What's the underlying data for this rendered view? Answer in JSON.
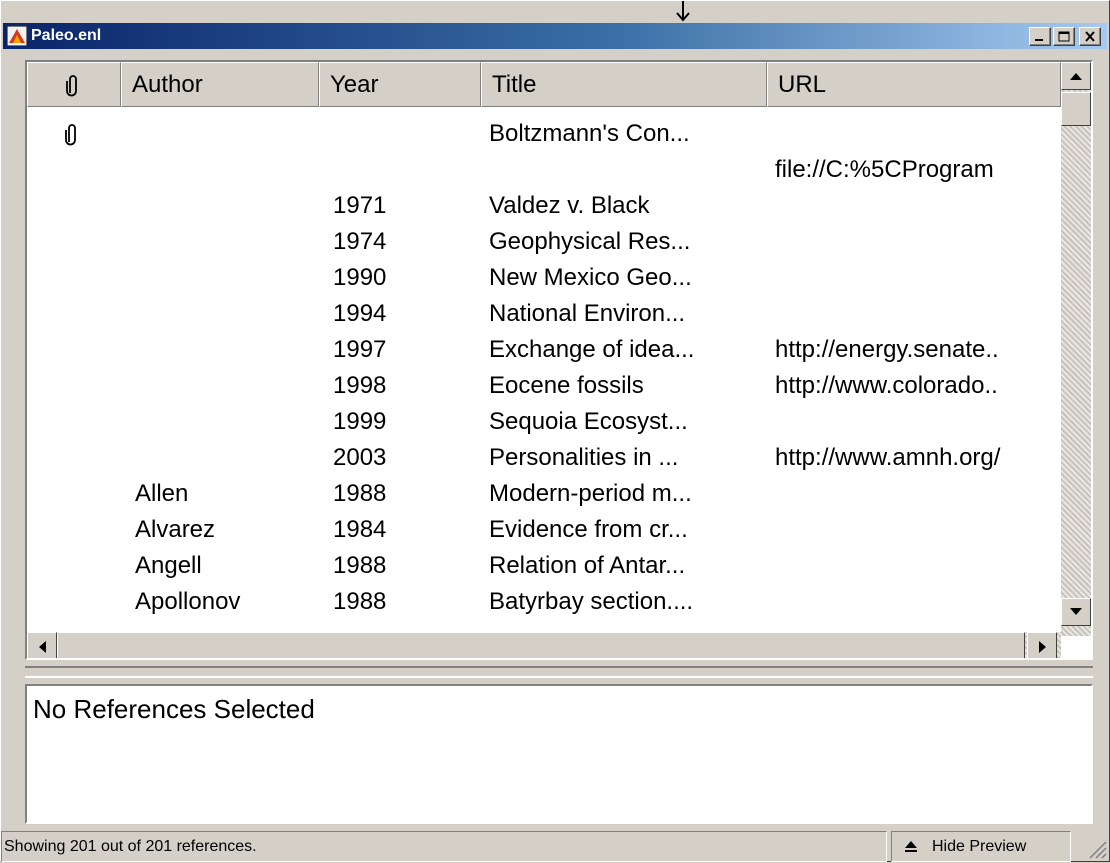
{
  "window": {
    "title": "Paleo.enl"
  },
  "columns": [
    {
      "label": ""
    },
    {
      "label": "Author"
    },
    {
      "label": "Year"
    },
    {
      "label": "Title"
    },
    {
      "label": "URL"
    }
  ],
  "rows": [
    {
      "attachment": true,
      "author": "",
      "year": "",
      "title": "Boltzmann's Con...",
      "url": ""
    },
    {
      "attachment": false,
      "author": "",
      "year": "",
      "title": "",
      "url": "file://C:%5CProgram"
    },
    {
      "attachment": false,
      "author": "",
      "year": "1971",
      "title": "Valdez v. Black",
      "url": ""
    },
    {
      "attachment": false,
      "author": "",
      "year": "1974",
      "title": "Geophysical Res...",
      "url": ""
    },
    {
      "attachment": false,
      "author": "",
      "year": "1990",
      "title": "New Mexico Geo...",
      "url": ""
    },
    {
      "attachment": false,
      "author": "",
      "year": "1994",
      "title": "National Environ...",
      "url": ""
    },
    {
      "attachment": false,
      "author": "",
      "year": "1997",
      "title": "Exchange of idea...",
      "url": "http://energy.senate.."
    },
    {
      "attachment": false,
      "author": "",
      "year": "1998",
      "title": "Eocene fossils",
      "url": "http://www.colorado.."
    },
    {
      "attachment": false,
      "author": "",
      "year": "1999",
      "title": "Sequoia Ecosyst...",
      "url": ""
    },
    {
      "attachment": false,
      "author": "",
      "year": "2003",
      "title": "Personalities in ...",
      "url": "http://www.amnh.org/"
    },
    {
      "attachment": false,
      "author": "Allen",
      "year": "1988",
      "title": "Modern-period m...",
      "url": ""
    },
    {
      "attachment": false,
      "author": "Alvarez",
      "year": "1984",
      "title": "Evidence from cr...",
      "url": ""
    },
    {
      "attachment": false,
      "author": "Angell",
      "year": "1988",
      "title": "Relation of Antar...",
      "url": ""
    },
    {
      "attachment": false,
      "author": "Apollonov",
      "year": "1988",
      "title": "Batyrbay section....",
      "url": ""
    }
  ],
  "preview": {
    "text": "No References Selected"
  },
  "status": {
    "text": "Showing 201 out of 201 references.",
    "hide_preview_label": "Hide Preview"
  },
  "icons": {
    "attachment": "paperclip-icon",
    "app": "endnote-app-icon",
    "hide_preview": "up-arrow-icon"
  }
}
